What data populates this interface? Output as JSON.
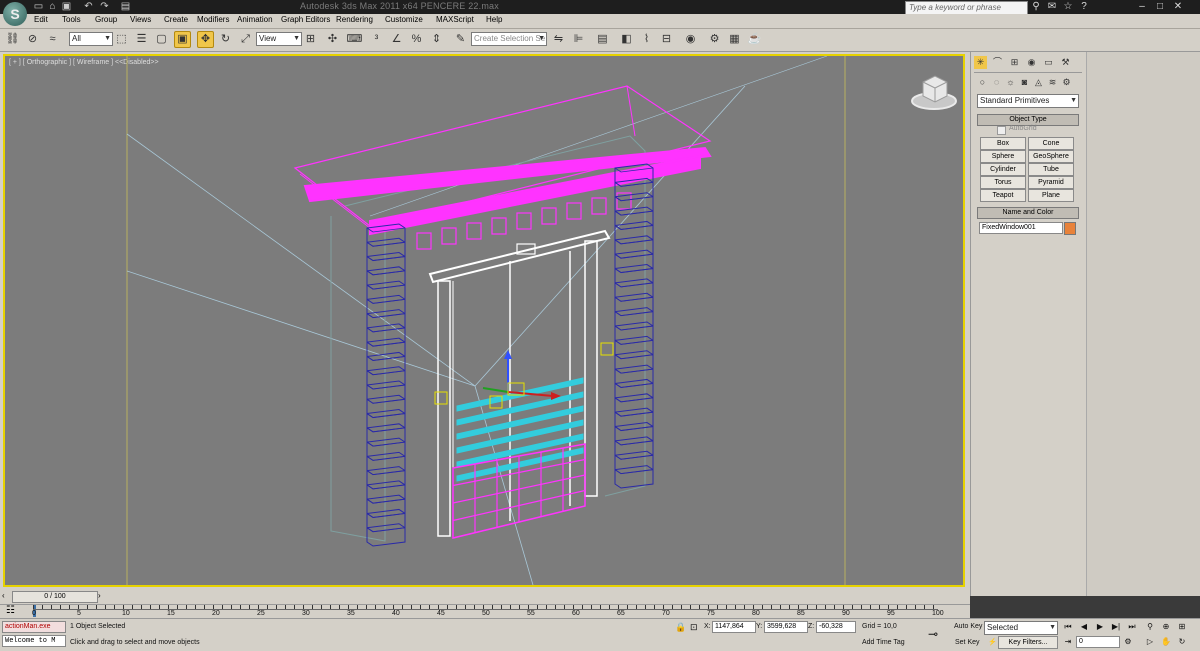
{
  "window": {
    "title": "Autodesk 3ds Max  2011 x64     PENCERE 22.max",
    "search_placeholder": "Type a keyword or phrase"
  },
  "menu": [
    "Edit",
    "Tools",
    "Group",
    "Views",
    "Create",
    "Modifiers",
    "Animation",
    "Graph Editors",
    "Rendering",
    "Customize",
    "MAXScript",
    "Help"
  ],
  "toolbar": {
    "filter_value": "All",
    "refcoord_value": "View",
    "selection_set_placeholder": "Create Selection Se"
  },
  "viewport": {
    "label": "[ + ] [ Orthographic ] [ Wireframe ]  <<Disabled>>"
  },
  "command_panel": {
    "category_value": "Standard Primitives",
    "object_type_title": "Object Type",
    "autogrid_label": "AutoGrid",
    "buttons": [
      "Box",
      "Cone",
      "Sphere",
      "GeoSphere",
      "Cylinder",
      "Tube",
      "Torus",
      "Pyramid",
      "Teapot",
      "Plane"
    ],
    "name_color_title": "Name and Color",
    "object_name": "FixedWindow001",
    "object_color": "#e8823a"
  },
  "timeline": {
    "slider_label": "0 / 100",
    "ticks": [
      "0",
      "5",
      "10",
      "15",
      "20",
      "25",
      "30",
      "35",
      "40",
      "45",
      "50",
      "55",
      "60",
      "65",
      "70",
      "75",
      "80",
      "85",
      "90",
      "95",
      "100"
    ]
  },
  "status": {
    "script_listener_top": "actionMan.exe",
    "script_listener_bottom": "Welcome to M",
    "selection_info": "1 Object Selected",
    "prompt": "Click and drag to select and move objects",
    "x_label": "X:",
    "x_value": "1147,864",
    "y_label": "Y:",
    "y_value": "3599,628",
    "z_label": "Z:",
    "z_value": "-60,328",
    "grid": "Grid = 10,0",
    "add_time_tag": "Add Time Tag",
    "auto_key": "Auto Key",
    "auto_key_value": "Selected",
    "set_key": "Set Key",
    "key_filters": "Key Filters...",
    "frame_value": "0"
  },
  "colors": {
    "viewport_bg": "#7c7c7c",
    "active_border": "#e6d200",
    "selected_magenta": "#ff33ff",
    "column_blue": "#2a2aa8",
    "blinds_cyan": "#33ccdd"
  }
}
